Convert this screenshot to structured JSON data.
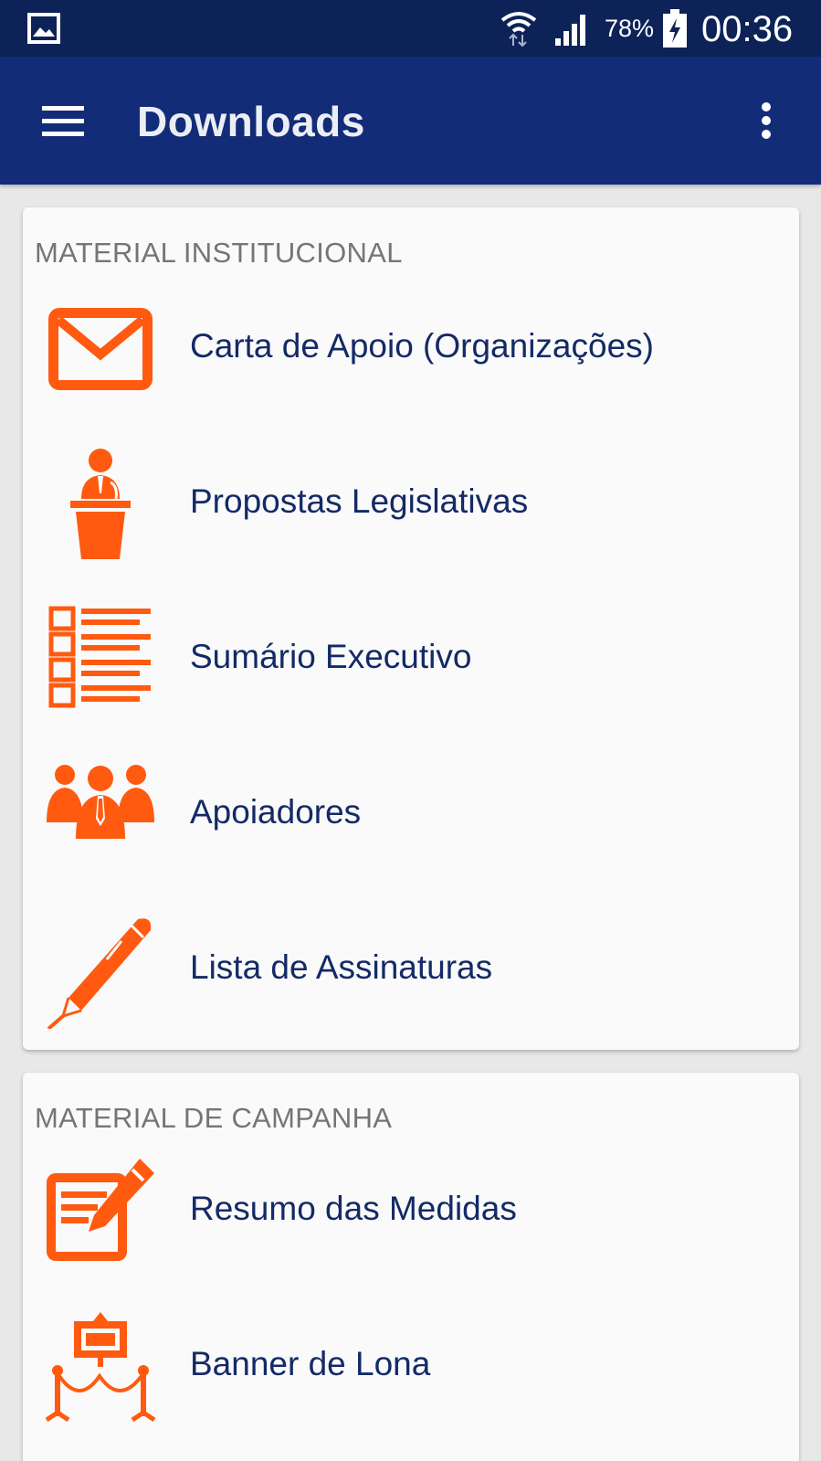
{
  "status_bar": {
    "battery_percent": "78%",
    "time": "00:36",
    "icons": [
      "image-icon",
      "wifi-icon",
      "signal-icon",
      "battery-charging-icon"
    ]
  },
  "app_bar": {
    "title": "Downloads",
    "menu_icon": "hamburger-menu-icon",
    "overflow_icon": "more-vert-icon"
  },
  "sections": [
    {
      "title": "MATERIAL INSTITUCIONAL",
      "items": [
        {
          "label": "Carta de Apoio (Organizações)",
          "icon": "envelope-icon"
        },
        {
          "label": "Propostas Legislativas",
          "icon": "speaker-podium-icon"
        },
        {
          "label": "Sumário Executivo",
          "icon": "checklist-icon"
        },
        {
          "label": "Apoiadores",
          "icon": "group-people-icon"
        },
        {
          "label": "Lista de Assinaturas",
          "icon": "pen-icon"
        }
      ]
    },
    {
      "title": "MATERIAL DE CAMPANHA",
      "items": [
        {
          "label": "Resumo das Medidas",
          "icon": "edit-document-icon"
        },
        {
          "label": "Banner de Lona",
          "icon": "banner-stanchion-icon"
        }
      ]
    }
  ],
  "colors": {
    "status_bar": "#0d2358",
    "app_bar": "#122c78",
    "accent_orange": "#ff5a10",
    "item_text": "#142a66",
    "section_title": "#757575",
    "card_bg": "#fafafa",
    "page_bg": "#e8e8e8"
  }
}
